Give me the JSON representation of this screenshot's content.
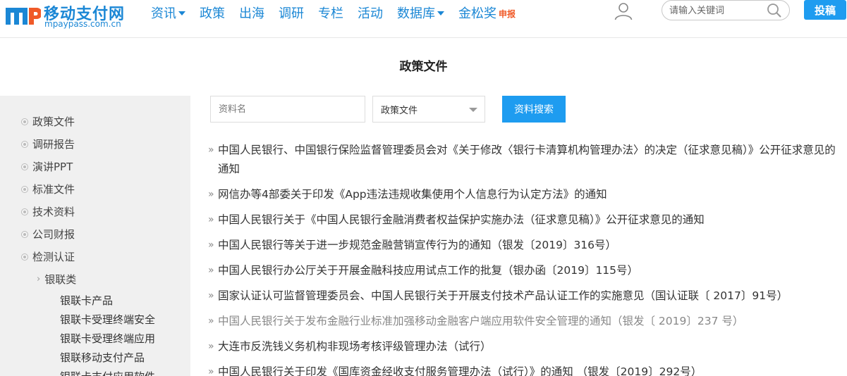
{
  "header": {
    "logo_cn": "移动支付网",
    "logo_en": "mpaypass.com.cn",
    "nav": [
      {
        "label": "资讯",
        "dropdown": true
      },
      {
        "label": "政策",
        "dropdown": false
      },
      {
        "label": "出海",
        "dropdown": false
      },
      {
        "label": "调研",
        "dropdown": false
      },
      {
        "label": "专栏",
        "dropdown": false
      },
      {
        "label": "活动",
        "dropdown": false
      },
      {
        "label": "数据库",
        "dropdown": true
      },
      {
        "label": "金松奖",
        "dropdown": false,
        "badge": "申报"
      }
    ],
    "search_placeholder": "请输入关键词",
    "submit_label": "投稿",
    "accent_color": "#1b87d5",
    "button_color": "#1e9cf0",
    "badge_color": "#f05a28"
  },
  "page_title": "政策文件",
  "sidebar": {
    "items": [
      "政策文件",
      "调研报告",
      "演讲PPT",
      "标准文件",
      "技术资料",
      "公司财报",
      "检测认证"
    ],
    "sub_category": "银联类",
    "leaves": [
      "银联卡产品",
      "银联卡受理终端安全",
      "银联卡受理终端应用",
      "银联移动支付产品",
      "银联卡支付应用软件"
    ]
  },
  "filter": {
    "name_placeholder": "资料名",
    "category_value": "政策文件",
    "search_label": "资料搜索"
  },
  "documents": [
    {
      "title": "中国人民银行、中国银行保险监督管理委员会对《关于修改〈银行卡清算机构管理办法〉的决定（征求意见稿）》公开征求意见的通知",
      "visited": false
    },
    {
      "title": "网信办等4部委关于印发《App违法违规收集使用个人信息行为认定方法》的通知",
      "visited": false
    },
    {
      "title": "中国人民银行关于《中国人民银行金融消费者权益保护实施办法（征求意见稿）》公开征求意见的通知",
      "visited": false
    },
    {
      "title": "中国人民银行等关于进一步规范金融营销宣传行为的通知（银发〔2019〕316号）",
      "visited": false
    },
    {
      "title": "中国人民银行办公厅关于开展金融科技应用试点工作的批复（银办函〔2019〕115号）",
      "visited": false
    },
    {
      "title": "国家认证认可监督管理委员会、中国人民银行关于开展支付技术产品认证工作的实施意见（国认证联〔 2017〕91号）",
      "visited": false
    },
    {
      "title": "中国人民银行关于发布金融行业标准加强移动金融客户端应用软件安全管理的通知（银发〔 2019〕237 号）",
      "visited": true
    },
    {
      "title": "大连市反洗钱义务机构非现场考核评级管理办法（试行）",
      "visited": false
    },
    {
      "title": "中国人民银行关于印发《国库资金经收支付服务管理办法（试行）》的通知 （银发〔2019〕292号）",
      "visited": false
    }
  ]
}
